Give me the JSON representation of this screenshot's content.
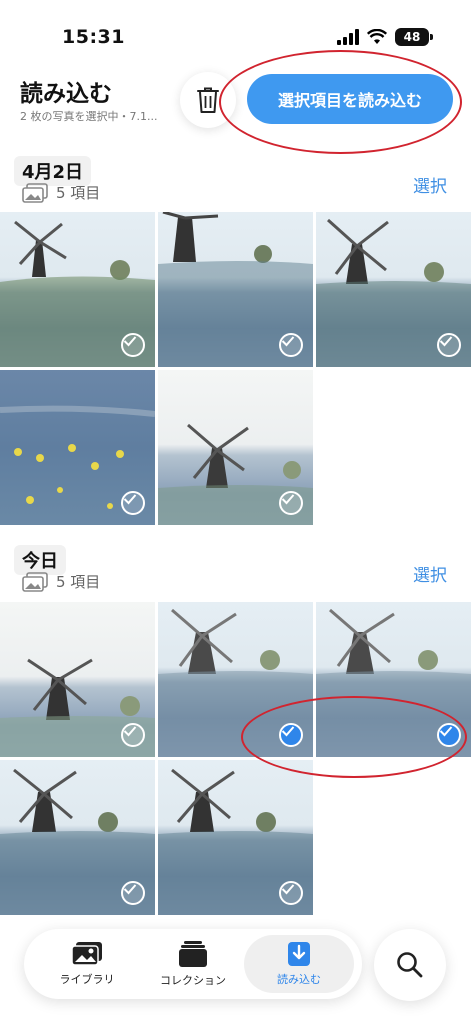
{
  "status_bar": {
    "time": "15:31",
    "battery": "48"
  },
  "header": {
    "title": "読み込む",
    "subtitle": "2 枚の写真を選択中・7.1...",
    "import_button_label": "選択項目を読み込む"
  },
  "sections": [
    {
      "date": "4月2日",
      "count": "5 項目",
      "select_label": "選択"
    },
    {
      "date": "今日",
      "count": "5 項目",
      "select_label": "選択"
    }
  ],
  "photos": {
    "section1": [
      {
        "selected": false
      },
      {
        "selected": false
      },
      {
        "selected": false
      },
      {
        "selected": false
      },
      {
        "selected": false
      }
    ],
    "section2": [
      {
        "selected": false
      },
      {
        "selected": true
      },
      {
        "selected": true
      },
      {
        "selected": false
      },
      {
        "selected": false
      }
    ]
  },
  "tab_bar": {
    "items": [
      {
        "label": "ライブラリ",
        "icon": "photo-library-icon"
      },
      {
        "label": "コレクション",
        "icon": "collection-stack-icon"
      },
      {
        "label": "読み込む",
        "icon": "import-icon",
        "active": true
      }
    ]
  },
  "colors": {
    "accent": "#3f99f0",
    "annotation": "#d1242f"
  }
}
